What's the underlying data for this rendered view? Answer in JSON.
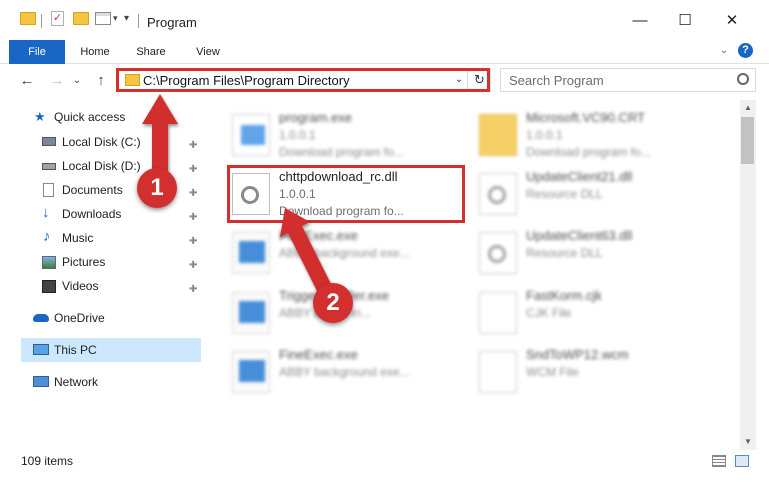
{
  "window": {
    "title": "Program",
    "minimize_glyph": "—",
    "maximize_glyph": "☐",
    "close_glyph": "✕",
    "quick_access_icons": [
      "folder-icon",
      "properties-check-icon",
      "new-folder-icon",
      "customize-toolbar-icon"
    ]
  },
  "ribbon": {
    "tabs": [
      "File",
      "Home",
      "Share",
      "View"
    ],
    "expand_glyph": "⌄",
    "help_glyph": "?"
  },
  "address": {
    "path": "C:\\Program Files\\Program Directory",
    "back_glyph": "←",
    "forward_glyph": "→",
    "recent_glyph": "⌄",
    "up_glyph": "↑",
    "refresh_glyph": "↻",
    "dropdown_glyph": "⌄"
  },
  "search": {
    "placeholder": "Search Program"
  },
  "sidebar": {
    "quick_access": "Quick access",
    "items": [
      {
        "label": "Local Disk (C:)",
        "icon": "drive-icon"
      },
      {
        "label": "Local Disk (D:)",
        "icon": "drive-icon"
      },
      {
        "label": "Documents",
        "icon": "documents-icon"
      },
      {
        "label": "Downloads",
        "icon": "downloads-icon"
      },
      {
        "label": "Music",
        "icon": "music-icon"
      },
      {
        "label": "Pictures",
        "icon": "pictures-icon"
      },
      {
        "label": "Videos",
        "icon": "videos-icon"
      }
    ],
    "pin_glyph": "📌",
    "onedrive": "OneDrive",
    "this_pc": "This PC",
    "network": "Network"
  },
  "files": {
    "left": [
      {
        "name": "program.exe",
        "line2": "1.0.0.1",
        "line3": "Download program fo..."
      },
      {
        "name": "chttpdownload_rc.dll",
        "line2": "1.0.0.1",
        "line3": "Download program fo..."
      },
      {
        "name": "FineExec.exe",
        "line2": "ABBY background exe..."
      },
      {
        "name": "TriggerInstaller.exe",
        "line2": "ABBY loader tri..."
      },
      {
        "name": "FineExec.exe",
        "line2": "ABBY background exe..."
      }
    ],
    "right": [
      {
        "name": "Microsoft.VC90.CRT",
        "line2": "1.0.0.1",
        "line3": "Download program fo..."
      },
      {
        "name": "UpdateClient21.dll",
        "line2": "Resource DLL"
      },
      {
        "name": "UpdateClient63.dll",
        "line2": "Resource DLL"
      },
      {
        "name": "FastKorm.cjk",
        "line2": "CJK File"
      },
      {
        "name": "SndToWP12.wcm",
        "line2": "WCM File"
      }
    ]
  },
  "status": {
    "item_count": "109 items"
  },
  "annotations": {
    "step1": "1",
    "step2": "2",
    "accent_color": "#d32f2f"
  },
  "colors": {
    "file_tab": "#1a66c5",
    "selection": "#cce8ff"
  }
}
